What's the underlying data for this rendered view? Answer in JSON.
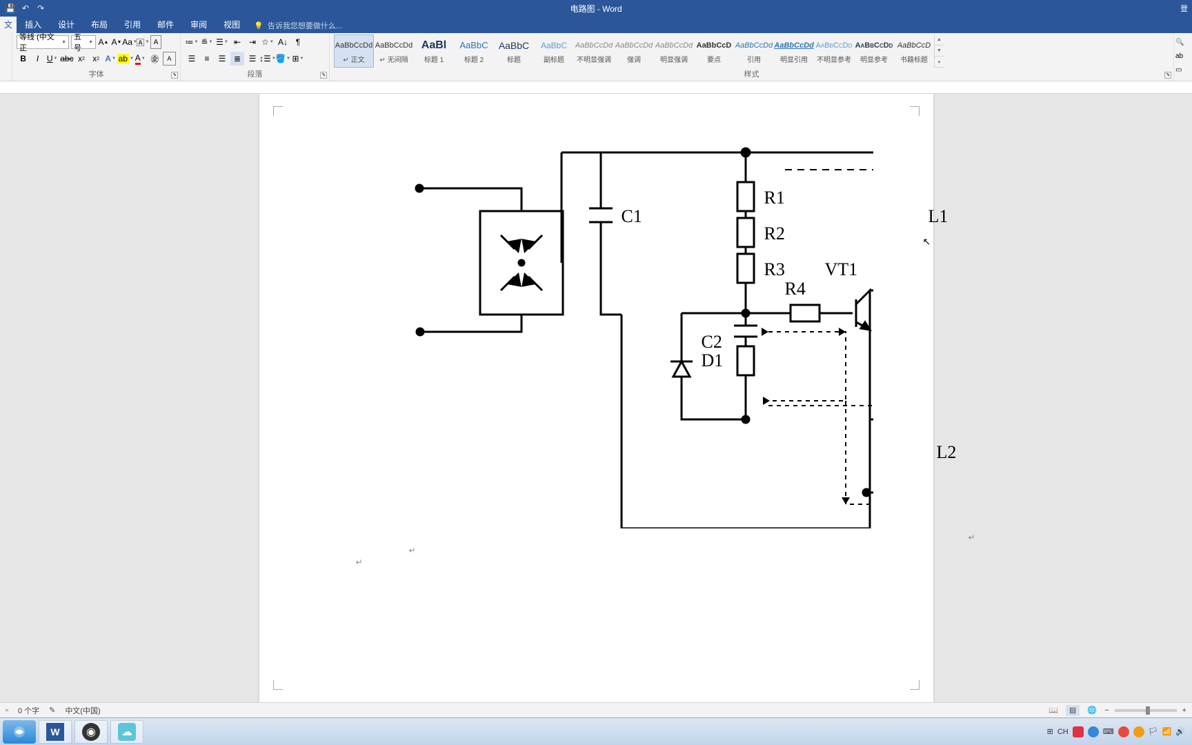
{
  "titlebar": {
    "title": "电路图 - Word",
    "login": "登"
  },
  "tabs": {
    "items": [
      "文",
      "插入",
      "设计",
      "布局",
      "引用",
      "邮件",
      "审阅",
      "视图"
    ],
    "tellme": "告诉我您想要做什么..."
  },
  "ribbon": {
    "font": {
      "family": "等线 (中文正",
      "size": "五号",
      "group_label": "字体"
    },
    "paragraph": {
      "group_label": "段落"
    },
    "styles": {
      "group_label": "样式",
      "items": [
        {
          "preview": "AaBbCcDd",
          "name": "↵ 正文",
          "cls": "",
          "sel": true
        },
        {
          "preview": "AaBbCcDd",
          "name": "↵ 无间隔",
          "cls": ""
        },
        {
          "preview": "AaBl",
          "name": "标题 1",
          "cls": "big"
        },
        {
          "preview": "AaBbC",
          "name": "标题 2",
          "cls": "h1"
        },
        {
          "preview": "AaBbC",
          "name": "标题",
          "cls": "t"
        },
        {
          "preview": "AaBbC",
          "name": "副标题",
          "cls": "st"
        },
        {
          "preview": "AaBbCcDd",
          "name": "不明显强调",
          "cls": "em"
        },
        {
          "preview": "AaBbCcDd",
          "name": "强调",
          "cls": "em"
        },
        {
          "preview": "AaBbCcDd",
          "name": "明显强调",
          "cls": "em"
        },
        {
          "preview": "AaBbCcD",
          "name": "要点",
          "cls": "strong"
        },
        {
          "preview": "AaBbCcDd",
          "name": "引用",
          "cls": "yy"
        },
        {
          "preview": "AaBbCcDd",
          "name": "明显引用",
          "cls": "myy"
        },
        {
          "preview": "AaBbCcDd",
          "name": "不明显参考",
          "cls": "bxck"
        },
        {
          "preview": "AaBbCcDd",
          "name": "明显参考",
          "cls": "mxck"
        },
        {
          "preview": "AaBbCcD",
          "name": "书籍标题",
          "cls": "book"
        }
      ]
    }
  },
  "circuit": {
    "labels": {
      "C1": "C1",
      "R1": "R1",
      "R2": "R2",
      "R3": "R3",
      "R4": "R4",
      "C2": "C2",
      "D1": "D1",
      "L1": "L1",
      "L2": "L2",
      "VT1": "VT1"
    }
  },
  "status": {
    "words": "0 个字",
    "lang": "中文(中国)"
  },
  "tray": {
    "ime": "CH"
  }
}
